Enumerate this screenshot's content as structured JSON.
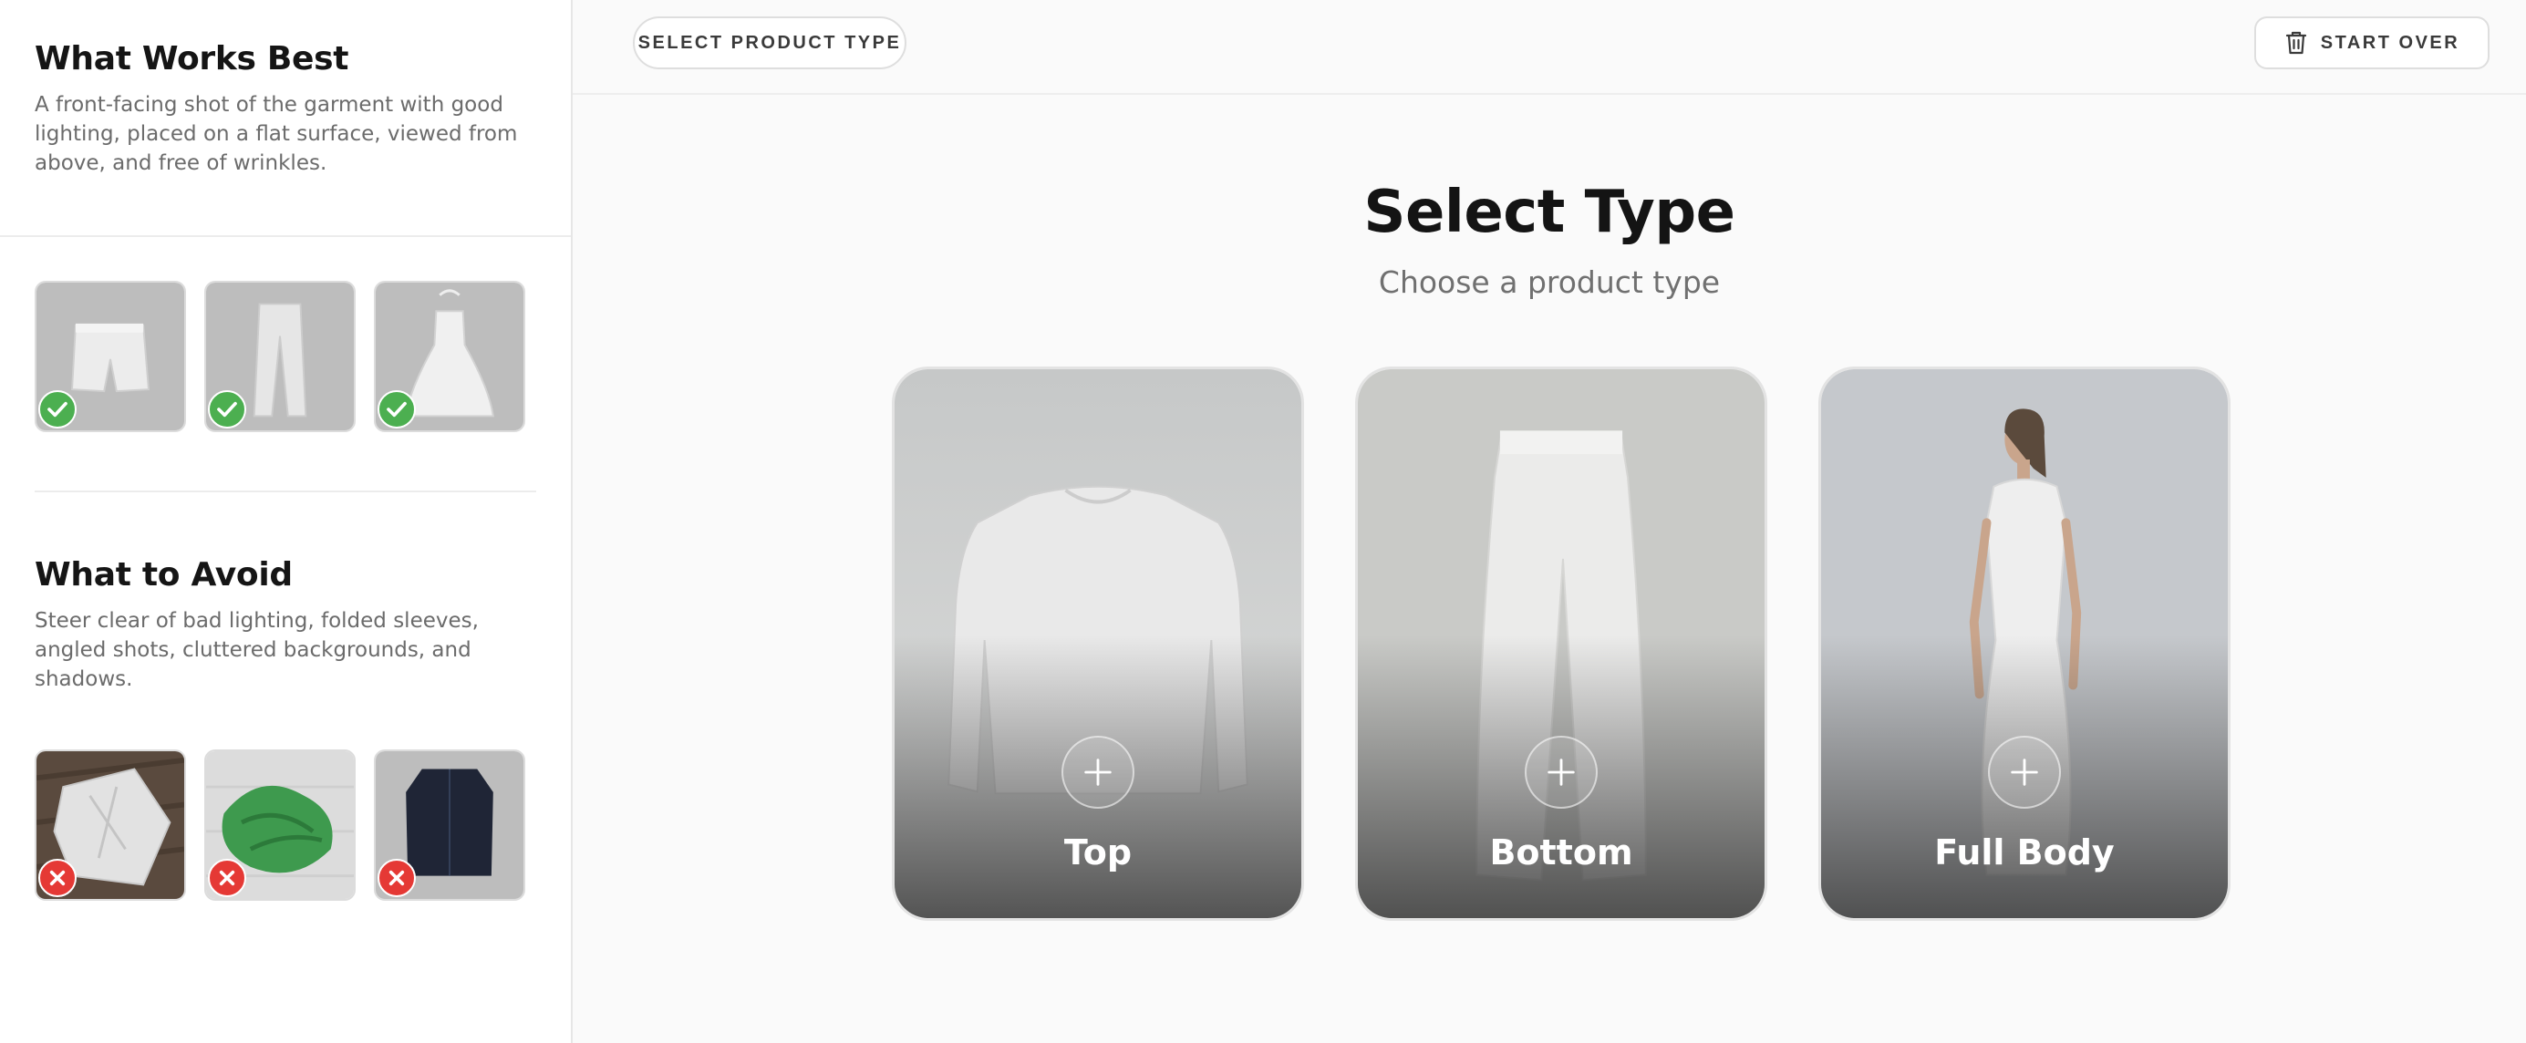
{
  "sidebar": {
    "best": {
      "title": "What Works Best",
      "text": "A front-facing shot of the garment with good lighting, placed on a flat surface, viewed from above, and free of wrinkles.",
      "examples": [
        "shorts",
        "trousers",
        "dress"
      ]
    },
    "avoid": {
      "title": "What to Avoid",
      "text": "Steer clear of bad lighting, folded sleeves, angled shots, cluttered backgrounds, and shadows.",
      "examples": [
        "crumpled-shirt",
        "green-garment",
        "dark-jacket"
      ]
    }
  },
  "toolbar": {
    "select_label": "SELECT PRODUCT TYPE",
    "start_over_label": "START OVER",
    "start_over_icon": "trash-icon"
  },
  "main": {
    "title": "Select Type",
    "subtitle": "Choose a product type",
    "cards": [
      {
        "label": "Top",
        "icon": "plus-icon"
      },
      {
        "label": "Bottom",
        "icon": "plus-icon"
      },
      {
        "label": "Full Body",
        "icon": "plus-icon"
      }
    ]
  },
  "colors": {
    "ok_badge": "#4caf50",
    "bad_badge": "#e53935",
    "thumb_bg": "#bdbdbd"
  }
}
